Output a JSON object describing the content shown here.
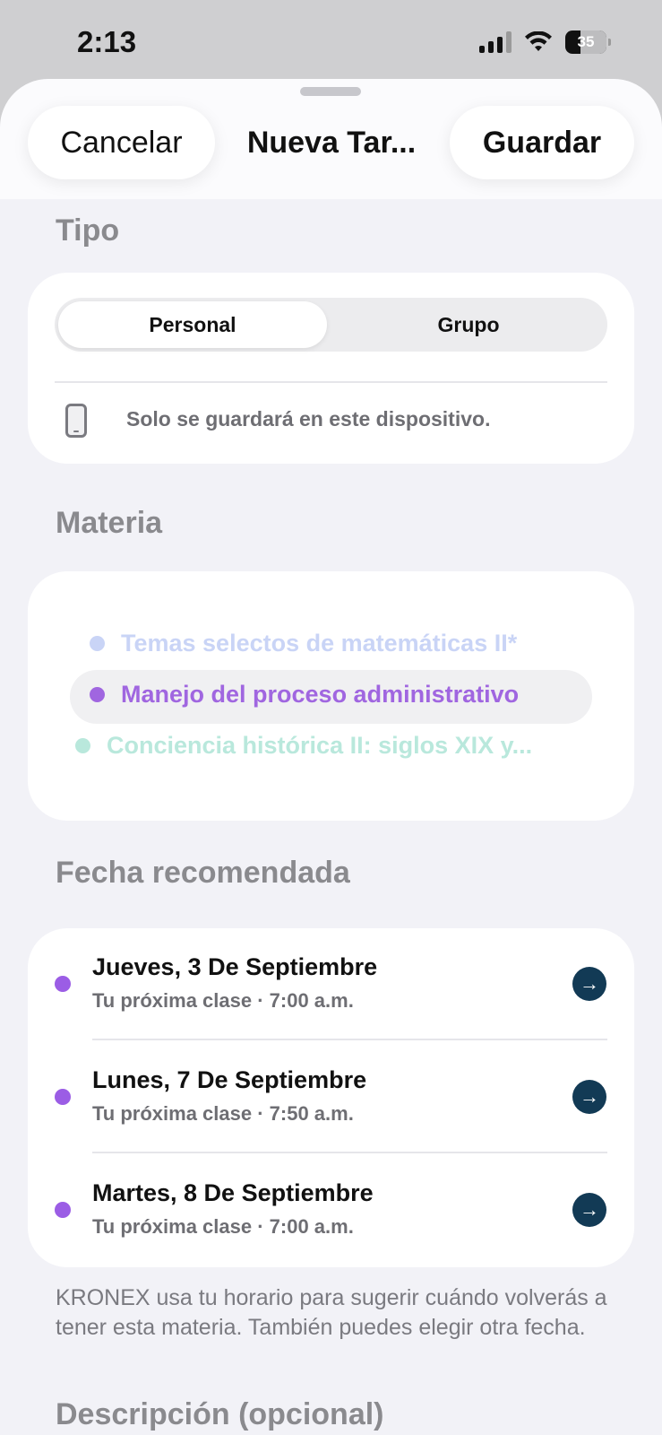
{
  "status": {
    "time": "2:13",
    "battery": "35"
  },
  "header": {
    "cancel_label": "Cancelar",
    "title": "Nueva Tar...",
    "save_label": "Guardar"
  },
  "tipo": {
    "label": "Tipo",
    "options": [
      "Personal",
      "Grupo"
    ],
    "selected": "Personal",
    "note": "Solo se guardará en este dispositivo."
  },
  "materia": {
    "label": "Materia",
    "items": [
      {
        "name": "Temas selectos de matemáticas II*",
        "color": "#c9d4f6"
      },
      {
        "name": "Manejo del proceso administrativo",
        "color": "#a066e0"
      },
      {
        "name": "Conciencia histórica II: siglos XIX y...",
        "color": "#b9e8dc"
      }
    ]
  },
  "fecha": {
    "label": "Fecha recomendada",
    "items": [
      {
        "title": "Jueves, 3 De Septiembre",
        "subtitle": "Tu próxima clase · 7:00 a.m."
      },
      {
        "title": "Lunes, 7 De Septiembre",
        "subtitle": "Tu próxima clase · 7:50 a.m."
      },
      {
        "title": "Martes, 8 De Septiembre",
        "subtitle": "Tu próxima clase · 7:00 a.m."
      }
    ],
    "note": "KRONEX usa tu horario para sugerir cuándo volverás a tener esta materia. También puedes elegir otra fecha."
  },
  "descripcion": {
    "label": "Descripción (opcional)"
  },
  "colors": {
    "accent_purple": "#9b5de5",
    "arrow_button": "#123a55",
    "background": "#f2f2f7"
  }
}
